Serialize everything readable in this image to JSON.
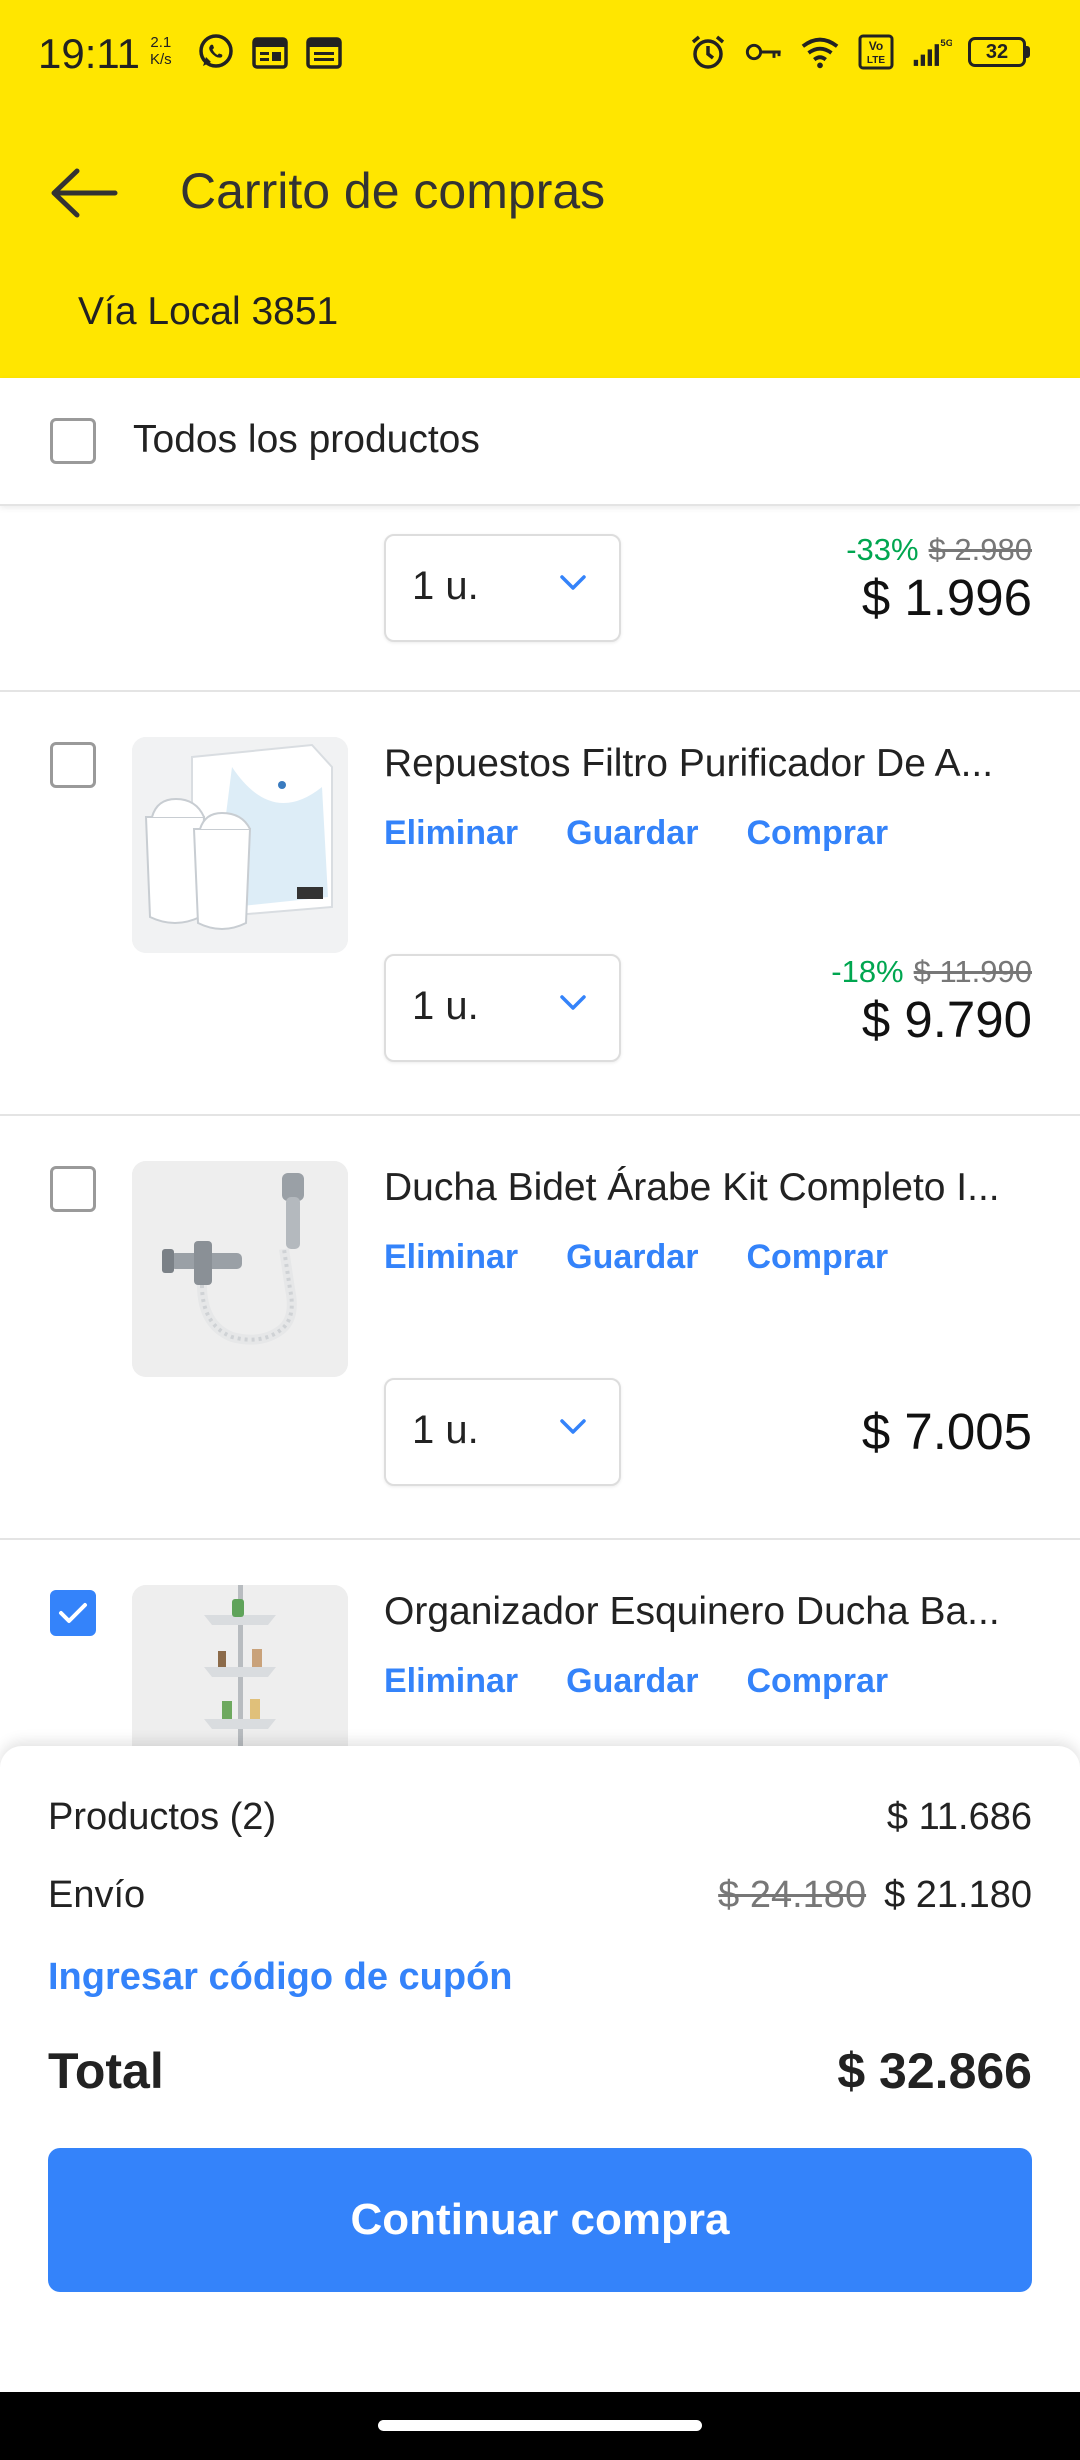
{
  "status_bar": {
    "time": "19:11",
    "speed_value": "2.1",
    "speed_unit": "K/s",
    "battery": "32"
  },
  "header": {
    "title": "Carrito de compras",
    "address": "Vía Local 3851"
  },
  "select_all": {
    "label": "Todos los productos",
    "checked": false
  },
  "items": [
    {
      "quantity": "1 u.",
      "discount": "-33%",
      "old_price": "$ 2.980",
      "price": "$ 1.996"
    },
    {
      "title": "Repuestos Filtro Purificador De A...",
      "checked": false,
      "actions": [
        "Eliminar",
        "Guardar",
        "Comprar"
      ],
      "quantity": "1 u.",
      "discount": "-18%",
      "old_price": "$ 11.990",
      "price": "$ 9.790"
    },
    {
      "title": "Ducha Bidet Árabe Kit Completo I...",
      "checked": false,
      "actions": [
        "Eliminar",
        "Guardar",
        "Comprar"
      ],
      "quantity": "1 u.",
      "price": "$ 7.005"
    },
    {
      "title": "Organizador Esquinero Ducha Ba...",
      "checked": true,
      "actions": [
        "Eliminar",
        "Guardar",
        "Comprar"
      ]
    }
  ],
  "summary": {
    "products_label": "Productos (2)",
    "products_value": "$ 11.686",
    "shipping_label": "Envío",
    "shipping_old": "$ 24.180",
    "shipping_value": "$ 21.180",
    "coupon_link": "Ingresar código de cupón",
    "total_label": "Total",
    "total_value": "$ 32.866",
    "cta": "Continuar compra"
  },
  "colors": {
    "header_bg": "#ffe600",
    "accent_blue": "#3483fa",
    "discount_green": "#00a650"
  }
}
